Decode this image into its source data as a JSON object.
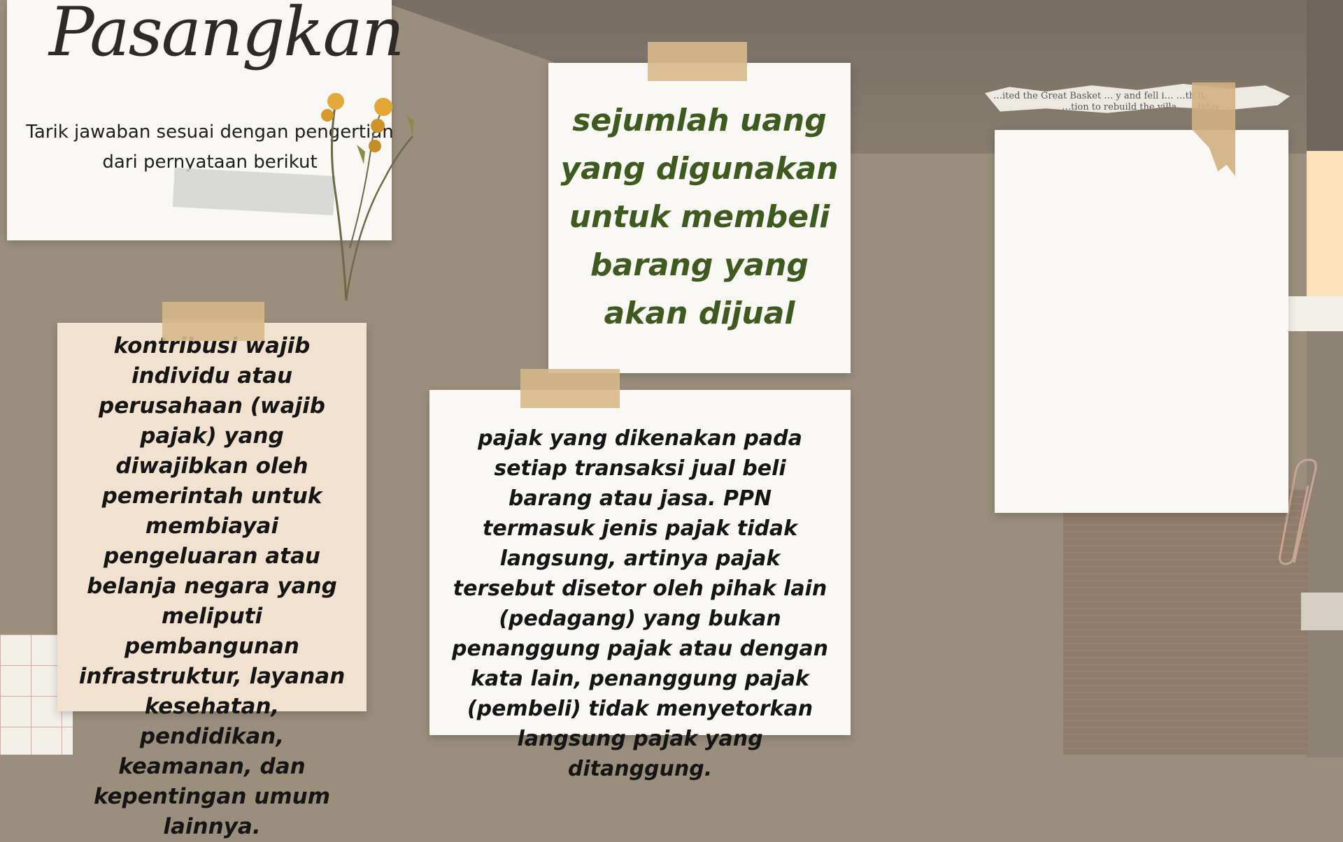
{
  "header": {
    "title": "Pasangkan",
    "instruction": "Tarik jawaban sesuai dengan pengertian dari pernyataan berikut"
  },
  "cards": {
    "left": "kontribusi wajib individu atau perusahaan (wajib pajak) yang diwajibkan oleh pemerintah untuk membiayai pengeluaran atau belanja negara yang meliputi pembangunan infrastruktur, layanan kesehatan, pendidikan, keamanan, dan kepentingan umum lainnya.",
    "top_center": "sejumlah uang yang digunakan untuk membeli barang yang akan dijual",
    "bottom_center": "pajak yang dikenakan pada setiap transaksi jual beli barang atau jasa. PPN termasuk jenis pajak tidak langsung, artinya pajak tersebut disetor oleh pihak lain (pedagang) yang bukan penanggung pajak atau dengan kata lain, penanggung pajak (pembeli) tidak menyetorkan langsung pajak yang ditanggung.",
    "right_answer": ""
  },
  "torn_paper": {
    "line1": "…ited the Great Basket … y and fell i… …th it.",
    "line2": "…tion to rebuild the villa… …liday"
  },
  "colors": {
    "background": "#9a8f7c",
    "accent_green": "#3e5a1e",
    "card_beige": "#f1e2cf",
    "card_white": "#faf8f4"
  }
}
